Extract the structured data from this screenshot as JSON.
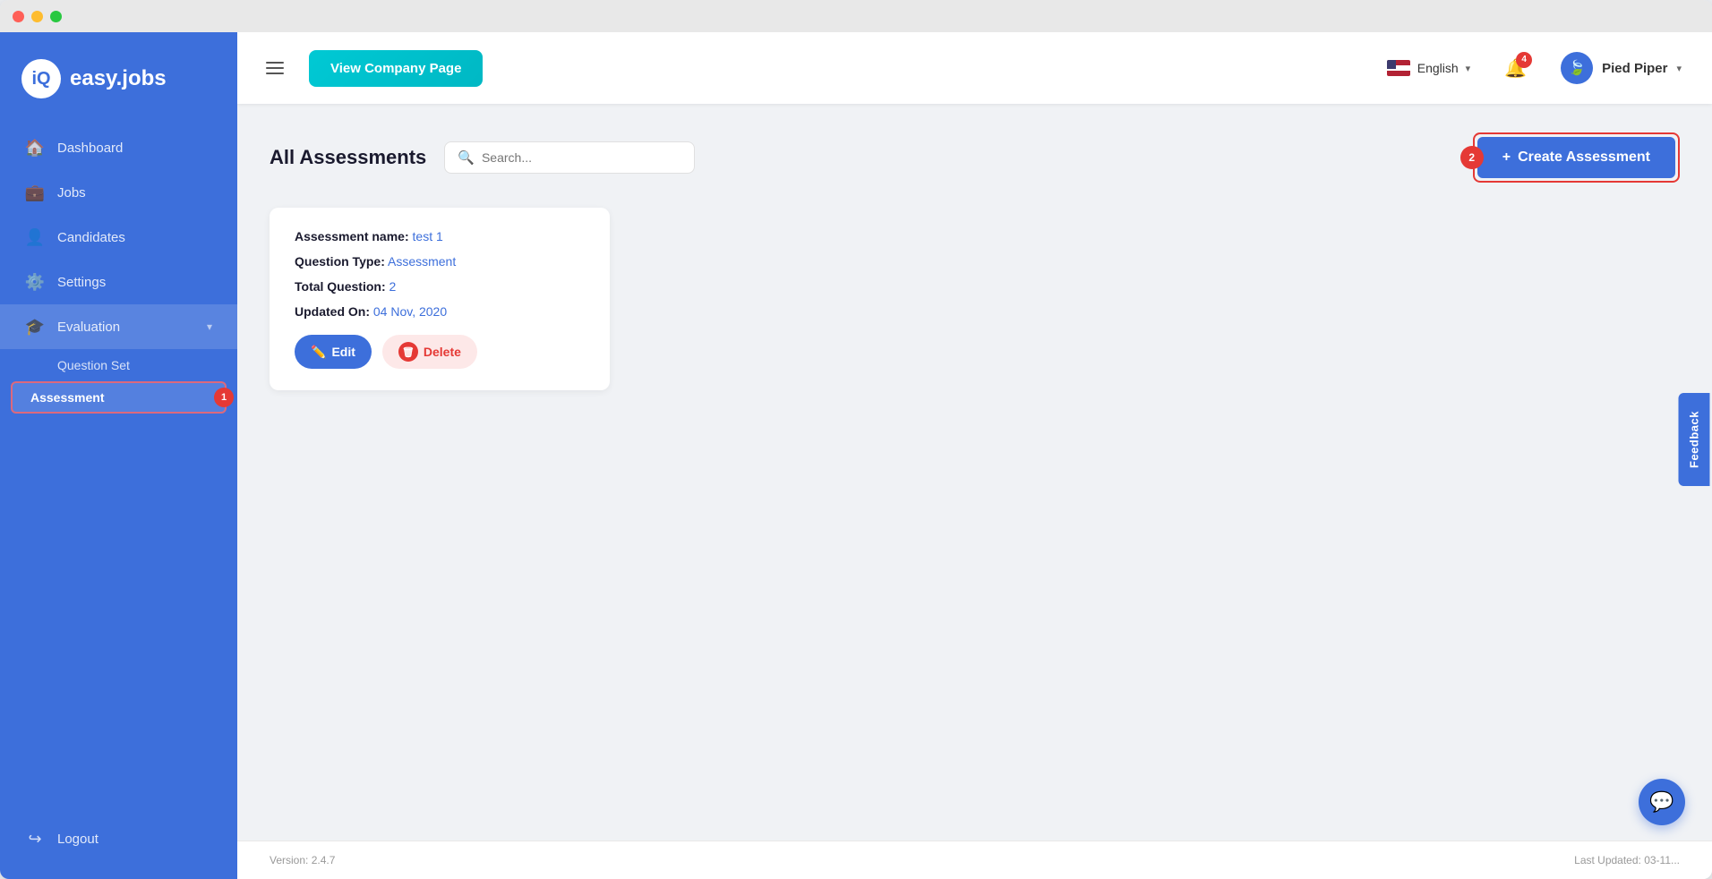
{
  "window": {
    "title": "easy.jobs"
  },
  "sidebar": {
    "logo_text": "easy.jobs",
    "logo_icon": "iq",
    "nav_items": [
      {
        "id": "dashboard",
        "label": "Dashboard",
        "icon": "🏠"
      },
      {
        "id": "jobs",
        "label": "Jobs",
        "icon": "💼"
      },
      {
        "id": "candidates",
        "label": "Candidates",
        "icon": "👤"
      },
      {
        "id": "settings",
        "label": "Settings",
        "icon": "⚙️"
      },
      {
        "id": "evaluation",
        "label": "Evaluation",
        "icon": "🎓",
        "has_chevron": true
      }
    ],
    "sub_items": [
      {
        "id": "question-set",
        "label": "Question Set"
      },
      {
        "id": "assessment",
        "label": "Assessment",
        "active": true,
        "step_badge": "1"
      }
    ],
    "logout_label": "Logout",
    "logout_icon": "↪"
  },
  "topbar": {
    "hamburger_label": "menu",
    "view_company_btn": "View Company Page",
    "language": "English",
    "notifications_count": "4",
    "user_name": "Pied Piper",
    "user_icon": "🍃",
    "chevron_down": "▾"
  },
  "content": {
    "page_title": "All Assessments",
    "search_placeholder": "Search...",
    "create_btn_label": "Create Assessment",
    "create_btn_step": "2",
    "create_btn_plus": "+",
    "assessment_card": {
      "name_label": "Assessment name:",
      "name_value": "test 1",
      "type_label": "Question Type:",
      "type_value": "Assessment",
      "total_label": "Total Question:",
      "total_value": "2",
      "updated_label": "Updated On:",
      "updated_value": "04 Nov, 2020",
      "edit_btn": "Edit",
      "delete_btn": "Delete"
    }
  },
  "footer": {
    "version": "Version: 2.4.7",
    "last_updated": "Last Updated: 03-11..."
  },
  "feedback": {
    "label": "Feedback"
  },
  "chat": {
    "icon": "💬"
  }
}
